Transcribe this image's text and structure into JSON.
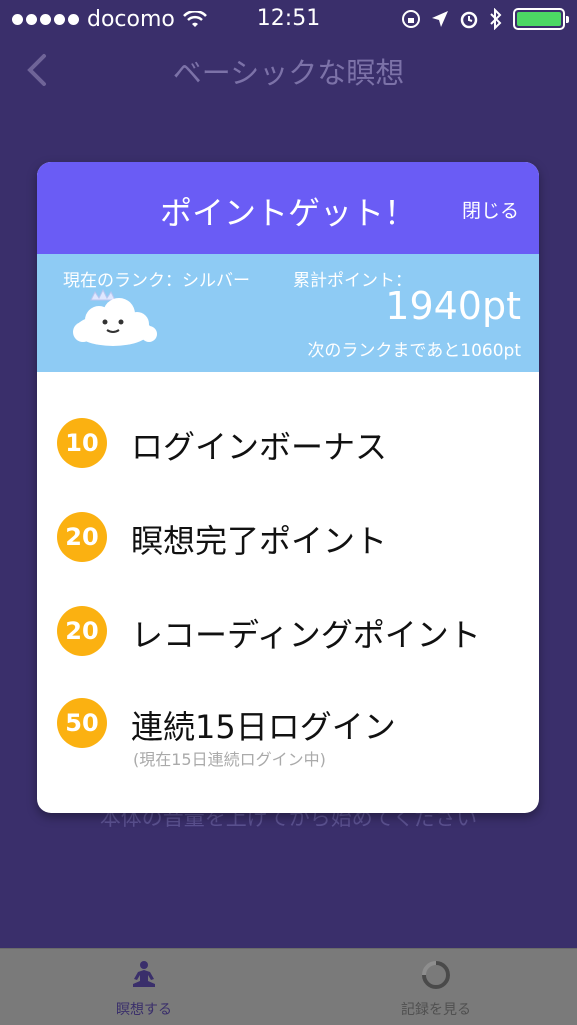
{
  "status_bar": {
    "carrier": "docomo",
    "time": "12:51"
  },
  "nav": {
    "title": "ベーシックな瞑想"
  },
  "background_hint": "本体の音量を上げてから始めてください",
  "modal": {
    "title": "ポイントゲット！",
    "close_label": "閉じる",
    "rank_label": "現在のランク：シルバー",
    "total_label": "累計ポイント：",
    "total_points": "1940pt",
    "next_rank_text": "次のランクまであと1060pt",
    "items": [
      {
        "points": "10",
        "label": "ログインボーナス",
        "sub": ""
      },
      {
        "points": "20",
        "label": "瞑想完了ポイント",
        "sub": ""
      },
      {
        "points": "20",
        "label": "レコーディングポイント",
        "sub": ""
      },
      {
        "points": "50",
        "label": "連続15日ログイン",
        "sub": "(現在15日連続ログイン中)"
      }
    ]
  },
  "tabbar": {
    "tabs": [
      {
        "label": "瞑想する",
        "icon": "meditate-icon"
      },
      {
        "label": "記録を見る",
        "icon": "progress-ring-icon"
      }
    ]
  },
  "colors": {
    "background": "#3a2f6b",
    "modal_header": "#6a5cf5",
    "rank_panel": "#8ecbf4",
    "badge": "#fbb111",
    "battery": "#4cd964"
  }
}
